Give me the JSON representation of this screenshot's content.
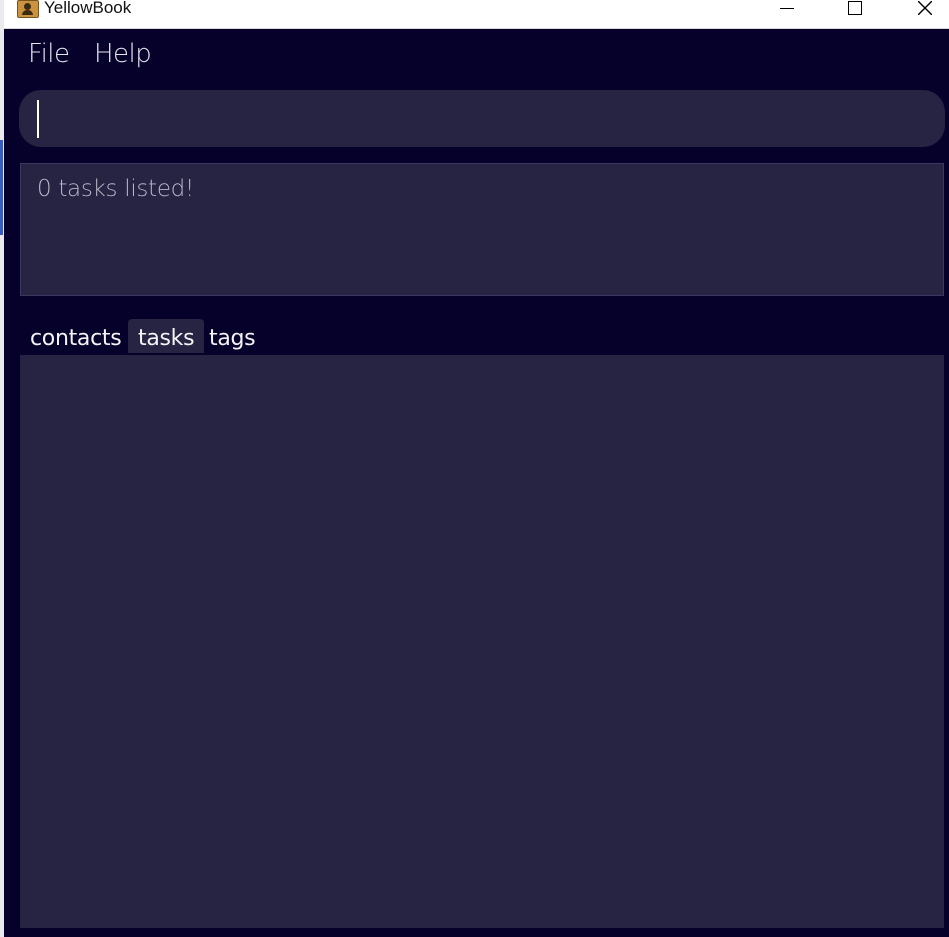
{
  "window": {
    "title": "YellowBook",
    "controls": [
      "minimize-icon",
      "maximize-icon",
      "close-icon"
    ]
  },
  "menu": {
    "items": [
      {
        "label": "File"
      },
      {
        "label": "Help"
      }
    ]
  },
  "command": {
    "value": "",
    "placeholder": ""
  },
  "result": {
    "message": "0 tasks listed!"
  },
  "tabs": [
    {
      "label": "contacts",
      "selected": false
    },
    {
      "label": "tasks",
      "selected": true
    },
    {
      "label": "tags",
      "selected": false
    }
  ],
  "list": {
    "items": []
  },
  "colors": {
    "background": "#05012b",
    "panel": "#272343",
    "text": "#e6e6f0",
    "muted_text": "#b9b7c8"
  }
}
